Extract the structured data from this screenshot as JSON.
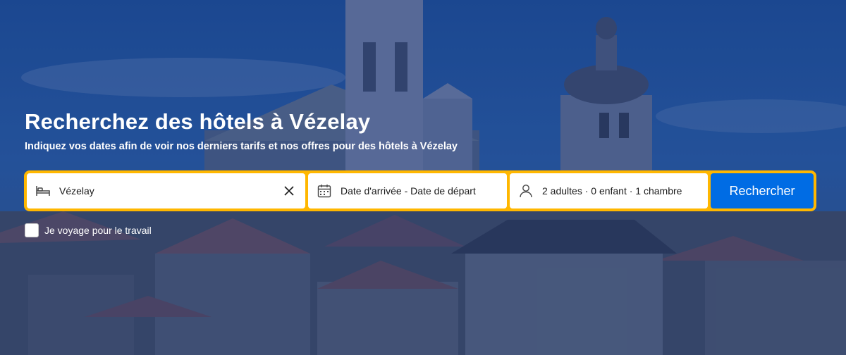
{
  "hero": {
    "title": "Recherchez des hôtels à Vézelay",
    "subtitle": "Indiquez vos dates afin de voir nos derniers tarifs et nos offres pour des hôtels à Vézelay"
  },
  "search": {
    "destination_value": "Vézelay",
    "destination_icon": "bed-icon",
    "clear_icon": "close-icon",
    "dates_label": "Date d'arrivée - Date de départ",
    "dates_icon": "calendar-icon",
    "guests_label": "2 adultes · 0 enfant · 1 chambre",
    "guests_icon": "person-icon",
    "button_label": "Rechercher"
  },
  "work_travel": {
    "label": "Je voyage pour le travail",
    "checked": false
  },
  "colors": {
    "accent_border": "#ffb700",
    "button": "#006ce4"
  }
}
